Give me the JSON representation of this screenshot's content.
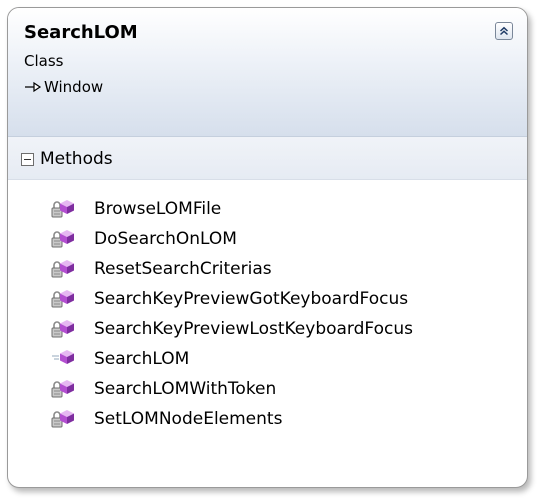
{
  "class": {
    "name": "SearchLOM",
    "kind": "Class",
    "base_type": "Window",
    "collapse_icon": "double-chevron-up-icon"
  },
  "methods_section": {
    "label": "Methods",
    "toggle_icon": "minus-box-icon"
  },
  "methods": [
    {
      "name": "BrowseLOMFile",
      "access": "private"
    },
    {
      "name": "DoSearchOnLOM",
      "access": "private"
    },
    {
      "name": "ResetSearchCriterias",
      "access": "private"
    },
    {
      "name": "SearchKeyPreviewGotKeyboardFocus",
      "access": "private"
    },
    {
      "name": "SearchKeyPreviewLostKeyboardFocus",
      "access": "private"
    },
    {
      "name": "SearchLOM",
      "access": "public"
    },
    {
      "name": "SearchLOMWithToken",
      "access": "private"
    },
    {
      "name": "SetLOMNodeElements",
      "access": "private"
    }
  ],
  "colors": {
    "method_cube": "#b34fd0",
    "lock": "#8a8a8a",
    "header_gradient_end": "#d6dfec"
  }
}
